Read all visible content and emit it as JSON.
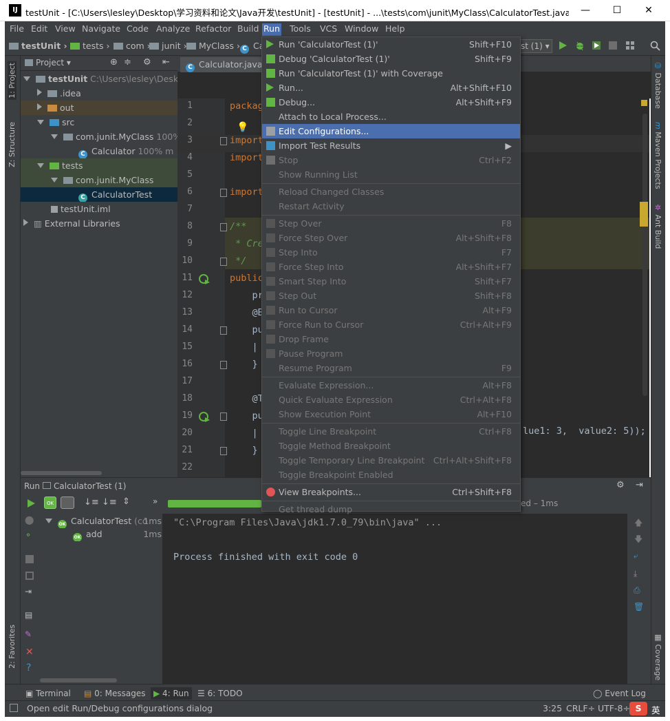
{
  "window": {
    "title": "testUnit - [C:\\Users\\lesley\\Desktop\\学习资料和论文\\Java开发\\testUnit] - [testUnit] - ...\\tests\\com\\junit\\MyClass\\CalculatorTest.java - Intel...",
    "logo": "IJ",
    "minimize": "—",
    "maximize": "☐",
    "close": "✕"
  },
  "menu": [
    "File",
    "Edit",
    "View",
    "Navigate",
    "Code",
    "Analyze",
    "Refactor",
    "Build",
    "Run",
    "Tools",
    "VCS",
    "Window",
    "Help"
  ],
  "breadcrumbs": [
    "testUnit",
    "tests",
    "com",
    "junit",
    "MyClass",
    "Ca"
  ],
  "run_config": "st (1)",
  "project_panel": {
    "title": "Project",
    "rows": [
      {
        "label": "testUnit",
        "extra": "C:\\Users\\lesley\\Deskto"
      },
      {
        "label": ".idea"
      },
      {
        "label": "out"
      },
      {
        "label": "src"
      },
      {
        "label": "com.junit.MyClass",
        "extra": "100%"
      },
      {
        "label": "Calculator",
        "extra": "100% m"
      },
      {
        "label": "tests"
      },
      {
        "label": "com.junit.MyClass"
      },
      {
        "label": "CalculatorTest"
      },
      {
        "label": "testUnit.iml"
      },
      {
        "label": "External Libraries"
      }
    ]
  },
  "left_tools": [
    "1: Project",
    "Z: Structure",
    "2: Favorites"
  ],
  "right_tools": [
    "Database",
    "Maven Projects",
    "Ant Build",
    "Coverage"
  ],
  "editor": {
    "tab": "Calculator.java",
    "line_numbers": [
      "1",
      "2",
      "3",
      "4",
      "5",
      "6",
      "7",
      "8",
      "9",
      "10",
      "11",
      "12",
      "13",
      "14",
      "15",
      "16",
      "17",
      "18",
      "19",
      "20",
      "21",
      "22"
    ],
    "lines": [
      "packag",
      "",
      "import",
      "import",
      "",
      "import",
      "",
      "/**",
      " * Cre",
      " */",
      "public",
      "    pr",
      "    @B",
      "    pu",
      "    |",
      "    }",
      "",
      "    @T",
      "    pu",
      "    |",
      "    }",
      ""
    ],
    "overflow": "lue1: 3,  value2: 5));"
  },
  "run_panel": {
    "title": "Run",
    "config": "CalculatorTest (1)",
    "status_tail": "ed – 1ms",
    "tree": [
      {
        "label": "CalculatorTest",
        "extra": "(co",
        "time": "1ms"
      },
      {
        "label": "add",
        "time": "1ms"
      }
    ],
    "console": [
      "\"C:\\Program Files\\Java\\jdk1.7.0_79\\bin\\java\" ...",
      "",
      "Process finished with exit code 0"
    ]
  },
  "run_menu": [
    {
      "label": "Run 'CalculatorTest (1)'",
      "shortcut": "Shift+F10"
    },
    {
      "label": "Debug 'CalculatorTest (1)'",
      "shortcut": "Shift+F9"
    },
    {
      "label": "Run 'CalculatorTest (1)' with Coverage",
      "shortcut": ""
    },
    {
      "label": "Run...",
      "shortcut": "Alt+Shift+F10"
    },
    {
      "label": "Debug...",
      "shortcut": "Alt+Shift+F9"
    },
    {
      "label": "Attach to Local Process...",
      "shortcut": ""
    },
    {
      "label": "Edit Configurations...",
      "shortcut": ""
    },
    {
      "label": "Import Test Results",
      "shortcut": "▶"
    },
    {
      "label": "Stop",
      "shortcut": "Ctrl+F2"
    },
    {
      "label": "Show Running List",
      "shortcut": ""
    },
    {
      "label": "Reload Changed Classes",
      "shortcut": ""
    },
    {
      "label": "Restart Activity",
      "shortcut": ""
    },
    {
      "label": "Step Over",
      "shortcut": "F8"
    },
    {
      "label": "Force Step Over",
      "shortcut": "Alt+Shift+F8"
    },
    {
      "label": "Step Into",
      "shortcut": "F7"
    },
    {
      "label": "Force Step Into",
      "shortcut": "Alt+Shift+F7"
    },
    {
      "label": "Smart Step Into",
      "shortcut": "Shift+F7"
    },
    {
      "label": "Step Out",
      "shortcut": "Shift+F8"
    },
    {
      "label": "Run to Cursor",
      "shortcut": "Alt+F9"
    },
    {
      "label": "Force Run to Cursor",
      "shortcut": "Ctrl+Alt+F9"
    },
    {
      "label": "Drop Frame",
      "shortcut": ""
    },
    {
      "label": "Pause Program",
      "shortcut": ""
    },
    {
      "label": "Resume Program",
      "shortcut": "F9"
    },
    {
      "label": "Evaluate Expression...",
      "shortcut": "Alt+F8"
    },
    {
      "label": "Quick Evaluate Expression",
      "shortcut": "Ctrl+Alt+F8"
    },
    {
      "label": "Show Execution Point",
      "shortcut": "Alt+F10"
    },
    {
      "label": "Toggle Line Breakpoint",
      "shortcut": "Ctrl+F8"
    },
    {
      "label": "Toggle Method Breakpoint",
      "shortcut": ""
    },
    {
      "label": "Toggle Temporary Line Breakpoint",
      "shortcut": "Ctrl+Alt+Shift+F8"
    },
    {
      "label": "Toggle Breakpoint Enabled",
      "shortcut": ""
    },
    {
      "label": "View Breakpoints...",
      "shortcut": "Ctrl+Shift+F8"
    },
    {
      "label": "Get thread dump",
      "shortcut": ""
    }
  ],
  "bottom_tabs": [
    "Terminal",
    "0: Messages",
    "4: Run",
    "6: TODO"
  ],
  "event_log": "Event Log",
  "status": {
    "message": "Open edit Run/Debug configurations dialog",
    "position": "3:25",
    "line_sep": "CRLF÷",
    "encoding": "UTF-8÷",
    "ime": "英"
  },
  "colors": {
    "accent": "#4b6eaf",
    "panel": "#3c3f41",
    "editor": "#2b2b2b",
    "run_green": "#62b543"
  }
}
